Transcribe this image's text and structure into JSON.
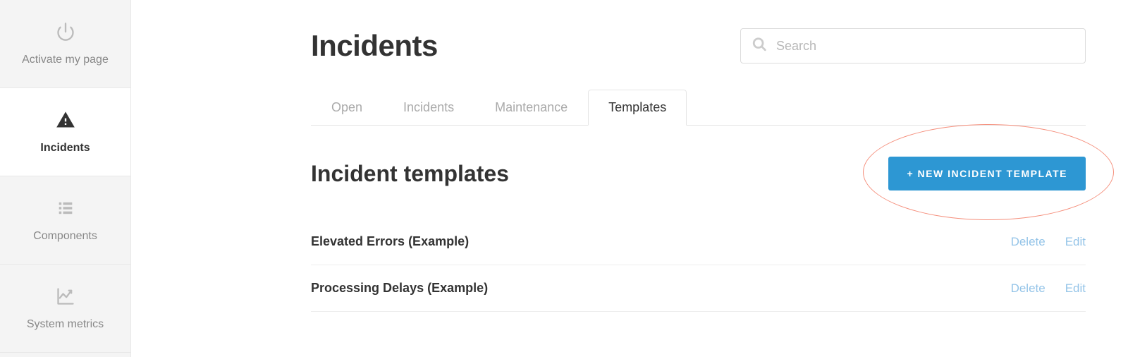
{
  "sidebar": {
    "items": [
      {
        "label": "Activate my page",
        "icon": "power-icon",
        "active": false
      },
      {
        "label": "Incidents",
        "icon": "warning-icon",
        "active": true
      },
      {
        "label": "Components",
        "icon": "list-icon",
        "active": false
      },
      {
        "label": "System metrics",
        "icon": "chart-icon",
        "active": false
      }
    ]
  },
  "page": {
    "title": "Incidents",
    "search_placeholder": "Search"
  },
  "tabs": [
    {
      "label": "Open",
      "active": false
    },
    {
      "label": "Incidents",
      "active": false
    },
    {
      "label": "Maintenance",
      "active": false
    },
    {
      "label": "Templates",
      "active": true
    }
  ],
  "section": {
    "title": "Incident templates",
    "new_button_label": "+ New Incident Template"
  },
  "templates": [
    {
      "name": "Elevated Errors (Example)",
      "delete_label": "Delete",
      "edit_label": "Edit"
    },
    {
      "name": "Processing Delays (Example)",
      "delete_label": "Delete",
      "edit_label": "Edit"
    }
  ],
  "colors": {
    "accent": "#2d97d3",
    "link": "#94c4e8",
    "callout": "#f58f7c"
  }
}
